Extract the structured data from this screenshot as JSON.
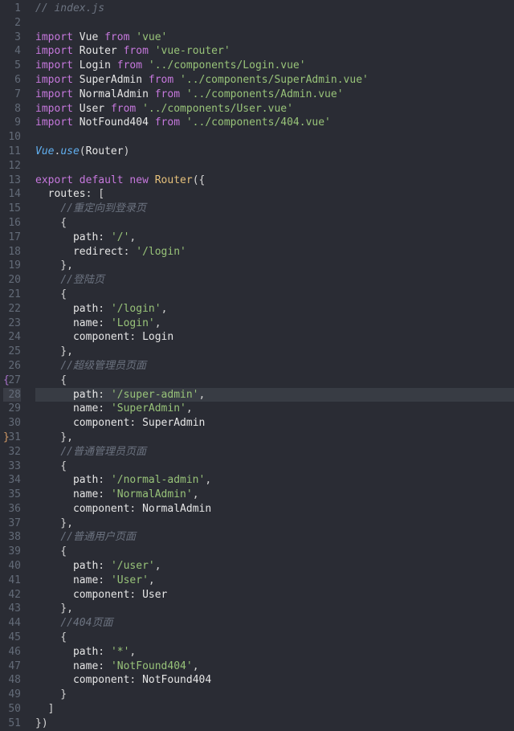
{
  "file": "index.js",
  "highlightLine": 28,
  "bracketMarks": {
    "27": "{",
    "31": "}"
  },
  "lines": [
    [
      [
        "c",
        "// index.js"
      ]
    ],
    [],
    [
      [
        "kw",
        "import"
      ],
      [
        "pn",
        " "
      ],
      [
        "idw",
        "Vue"
      ],
      [
        "pn",
        " "
      ],
      [
        "kw",
        "from"
      ],
      [
        "pn",
        " "
      ],
      [
        "str",
        "'vue'"
      ]
    ],
    [
      [
        "kw",
        "import"
      ],
      [
        "pn",
        " "
      ],
      [
        "idw",
        "Router"
      ],
      [
        "pn",
        " "
      ],
      [
        "kw",
        "from"
      ],
      [
        "pn",
        " "
      ],
      [
        "str",
        "'vue-router'"
      ]
    ],
    [
      [
        "kw",
        "import"
      ],
      [
        "pn",
        " "
      ],
      [
        "idw",
        "Login"
      ],
      [
        "pn",
        " "
      ],
      [
        "kw",
        "from"
      ],
      [
        "pn",
        " "
      ],
      [
        "str",
        "'../components/Login.vue'"
      ]
    ],
    [
      [
        "kw",
        "import"
      ],
      [
        "pn",
        " "
      ],
      [
        "idw",
        "SuperAdmin"
      ],
      [
        "pn",
        " "
      ],
      [
        "kw",
        "from"
      ],
      [
        "pn",
        " "
      ],
      [
        "str",
        "'../components/SuperAdmin.vue'"
      ]
    ],
    [
      [
        "kw",
        "import"
      ],
      [
        "pn",
        " "
      ],
      [
        "idw",
        "NormalAdmin"
      ],
      [
        "pn",
        " "
      ],
      [
        "kw",
        "from"
      ],
      [
        "pn",
        " "
      ],
      [
        "str",
        "'../components/Admin.vue'"
      ]
    ],
    [
      [
        "kw",
        "import"
      ],
      [
        "pn",
        " "
      ],
      [
        "idw",
        "User"
      ],
      [
        "pn",
        " "
      ],
      [
        "kw",
        "from"
      ],
      [
        "pn",
        " "
      ],
      [
        "str",
        "'../components/User.vue'"
      ]
    ],
    [
      [
        "kw",
        "import"
      ],
      [
        "pn",
        " "
      ],
      [
        "idw",
        "NotFound404"
      ],
      [
        "pn",
        " "
      ],
      [
        "kw",
        "from"
      ],
      [
        "pn",
        " "
      ],
      [
        "str",
        "'../components/404.vue'"
      ]
    ],
    [],
    [
      [
        "fn",
        "Vue"
      ],
      [
        "pn",
        "."
      ],
      [
        "fn",
        "use"
      ],
      [
        "pn",
        "("
      ],
      [
        "idw",
        "Router"
      ],
      [
        "pn",
        ")"
      ]
    ],
    [],
    [
      [
        "kw",
        "export"
      ],
      [
        "pn",
        " "
      ],
      [
        "kw",
        "default"
      ],
      [
        "pn",
        " "
      ],
      [
        "kw",
        "new"
      ],
      [
        "pn",
        " "
      ],
      [
        "id",
        "Router"
      ],
      [
        "pn",
        "({"
      ]
    ],
    [
      [
        "pn",
        "  "
      ],
      [
        "propw",
        "routes"
      ],
      [
        "pn",
        ": ["
      ]
    ],
    [
      [
        "pn",
        "    "
      ],
      [
        "c",
        "//重定向到登录页"
      ]
    ],
    [
      [
        "pn",
        "    {"
      ]
    ],
    [
      [
        "pn",
        "      "
      ],
      [
        "propw",
        "path"
      ],
      [
        "pn",
        ": "
      ],
      [
        "str",
        "'/'"
      ],
      [
        "pn",
        ","
      ]
    ],
    [
      [
        "pn",
        "      "
      ],
      [
        "propw",
        "redirect"
      ],
      [
        "pn",
        ": "
      ],
      [
        "str",
        "'/login'"
      ]
    ],
    [
      [
        "pn",
        "    },"
      ]
    ],
    [
      [
        "pn",
        "    "
      ],
      [
        "c",
        "//登陆页"
      ]
    ],
    [
      [
        "pn",
        "    {"
      ]
    ],
    [
      [
        "pn",
        "      "
      ],
      [
        "propw",
        "path"
      ],
      [
        "pn",
        ": "
      ],
      [
        "str",
        "'/login'"
      ],
      [
        "pn",
        ","
      ]
    ],
    [
      [
        "pn",
        "      "
      ],
      [
        "propw",
        "name"
      ],
      [
        "pn",
        ": "
      ],
      [
        "str",
        "'Login'"
      ],
      [
        "pn",
        ","
      ]
    ],
    [
      [
        "pn",
        "      "
      ],
      [
        "propw",
        "component"
      ],
      [
        "pn",
        ": "
      ],
      [
        "idw",
        "Login"
      ]
    ],
    [
      [
        "pn",
        "    },"
      ]
    ],
    [
      [
        "pn",
        "    "
      ],
      [
        "c",
        "//超级管理员页面"
      ]
    ],
    [
      [
        "pn",
        "    {"
      ]
    ],
    [
      [
        "pn",
        "      "
      ],
      [
        "propw",
        "path"
      ],
      [
        "pn",
        ": "
      ],
      [
        "str",
        "'/super-admin'"
      ],
      [
        "pn",
        ","
      ]
    ],
    [
      [
        "pn",
        "      "
      ],
      [
        "propw",
        "name"
      ],
      [
        "pn",
        ": "
      ],
      [
        "str",
        "'SuperAdmin'"
      ],
      [
        "pn",
        ","
      ]
    ],
    [
      [
        "pn",
        "      "
      ],
      [
        "propw",
        "component"
      ],
      [
        "pn",
        ": "
      ],
      [
        "idw",
        "SuperAdmin"
      ]
    ],
    [
      [
        "pn",
        "    },"
      ]
    ],
    [
      [
        "pn",
        "    "
      ],
      [
        "c",
        "//普通管理员页面"
      ]
    ],
    [
      [
        "pn",
        "    {"
      ]
    ],
    [
      [
        "pn",
        "      "
      ],
      [
        "propw",
        "path"
      ],
      [
        "pn",
        ": "
      ],
      [
        "str",
        "'/normal-admin'"
      ],
      [
        "pn",
        ","
      ]
    ],
    [
      [
        "pn",
        "      "
      ],
      [
        "propw",
        "name"
      ],
      [
        "pn",
        ": "
      ],
      [
        "str",
        "'NormalAdmin'"
      ],
      [
        "pn",
        ","
      ]
    ],
    [
      [
        "pn",
        "      "
      ],
      [
        "propw",
        "component"
      ],
      [
        "pn",
        ": "
      ],
      [
        "idw",
        "NormalAdmin"
      ]
    ],
    [
      [
        "pn",
        "    },"
      ]
    ],
    [
      [
        "pn",
        "    "
      ],
      [
        "c",
        "//普通用户页面"
      ]
    ],
    [
      [
        "pn",
        "    {"
      ]
    ],
    [
      [
        "pn",
        "      "
      ],
      [
        "propw",
        "path"
      ],
      [
        "pn",
        ": "
      ],
      [
        "str",
        "'/user'"
      ],
      [
        "pn",
        ","
      ]
    ],
    [
      [
        "pn",
        "      "
      ],
      [
        "propw",
        "name"
      ],
      [
        "pn",
        ": "
      ],
      [
        "str",
        "'User'"
      ],
      [
        "pn",
        ","
      ]
    ],
    [
      [
        "pn",
        "      "
      ],
      [
        "propw",
        "component"
      ],
      [
        "pn",
        ": "
      ],
      [
        "idw",
        "User"
      ]
    ],
    [
      [
        "pn",
        "    },"
      ]
    ],
    [
      [
        "pn",
        "    "
      ],
      [
        "c",
        "//404页面"
      ]
    ],
    [
      [
        "pn",
        "    {"
      ]
    ],
    [
      [
        "pn",
        "      "
      ],
      [
        "propw",
        "path"
      ],
      [
        "pn",
        ": "
      ],
      [
        "str",
        "'*'"
      ],
      [
        "pn",
        ","
      ]
    ],
    [
      [
        "pn",
        "      "
      ],
      [
        "propw",
        "name"
      ],
      [
        "pn",
        ": "
      ],
      [
        "str",
        "'NotFound404'"
      ],
      [
        "pn",
        ","
      ]
    ],
    [
      [
        "pn",
        "      "
      ],
      [
        "propw",
        "component"
      ],
      [
        "pn",
        ": "
      ],
      [
        "idw",
        "NotFound404"
      ]
    ],
    [
      [
        "pn",
        "    }"
      ]
    ],
    [
      [
        "pn",
        "  ]"
      ]
    ],
    [
      [
        "pn",
        "})"
      ]
    ]
  ]
}
